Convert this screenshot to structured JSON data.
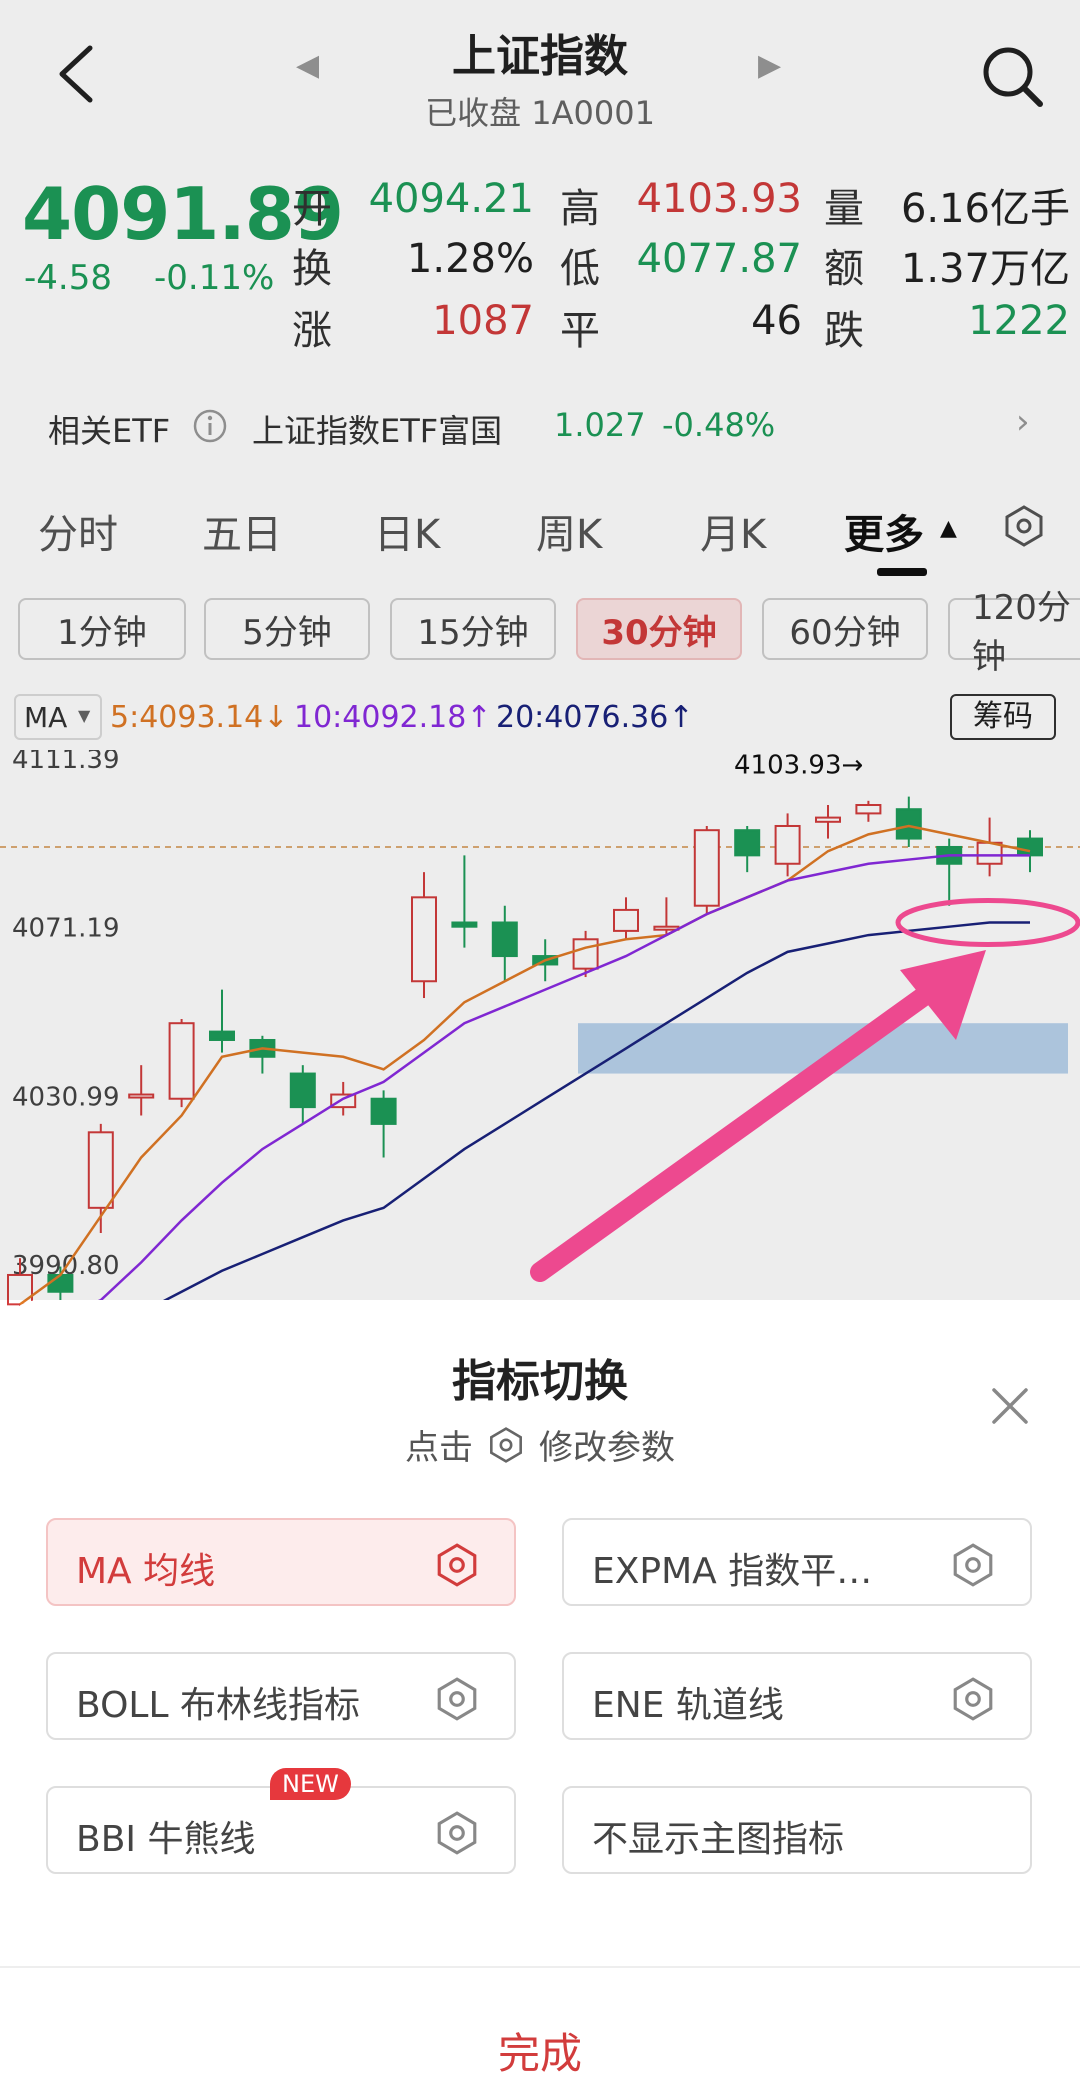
{
  "header": {
    "title": "上证指数",
    "subtitle": "已收盘 1A0001"
  },
  "quote": {
    "price": "4091.89",
    "change": "-4.58",
    "change_pct": "-0.11%",
    "stats": [
      {
        "label": "开",
        "value": "4094.21",
        "color": "green"
      },
      {
        "label": "高",
        "value": "4103.93",
        "color": "red"
      },
      {
        "label": "量",
        "value": "6.16亿手",
        "color": "dark"
      },
      {
        "label": "换",
        "value": "1.28%",
        "color": "dark"
      },
      {
        "label": "低",
        "value": "4077.87",
        "color": "green"
      },
      {
        "label": "额",
        "value": "1.37万亿",
        "color": "dark"
      },
      {
        "label": "涨",
        "value": "1087",
        "color": "red"
      },
      {
        "label": "平",
        "value": "46",
        "color": "dark"
      },
      {
        "label": "跌",
        "value": "1222",
        "color": "green"
      }
    ]
  },
  "etf": {
    "label": "相关ETF",
    "name": "上证指数ETF富国",
    "price": "1.027",
    "change": "-0.48%"
  },
  "tabs": [
    "分时",
    "五日",
    "日K",
    "周K",
    "月K",
    "更多"
  ],
  "active_tab": "更多",
  "periods": [
    "1分钟",
    "5分钟",
    "15分钟",
    "30分钟",
    "60分钟",
    "120分钟"
  ],
  "active_period": "30分钟",
  "ma": {
    "selector": "MA",
    "ma5": "5:4093.14↓",
    "ma10": "10:4092.18↑",
    "ma20": "20:4076.36↑",
    "chip_button": "筹码"
  },
  "chart_data": {
    "type": "candlestick",
    "y_ticks": [
      "4111.39",
      "4071.19",
      "4030.99",
      "3990.80"
    ],
    "high_marker": "4103.93→",
    "series_colors": {
      "ma5": "#e07a26",
      "ma10": "#8a2be2",
      "ma20": "#1a237e",
      "up": "#d23c3c",
      "down": "#1e9c5a"
    },
    "candles": [
      {
        "o": 3985,
        "c": 3992,
        "h": 3996,
        "l": 3982
      },
      {
        "o": 3992,
        "c": 3988,
        "h": 3994,
        "l": 3984
      },
      {
        "o": 4008,
        "c": 4026,
        "h": 4028,
        "l": 4002
      },
      {
        "o": 4035,
        "c": 4035,
        "h": 4042,
        "l": 4030
      },
      {
        "o": 4034,
        "c": 4052,
        "h": 4053,
        "l": 4032
      },
      {
        "o": 4050,
        "c": 4048,
        "h": 4060,
        "l": 4045
      },
      {
        "o": 4048,
        "c": 4044,
        "h": 4049,
        "l": 4040
      },
      {
        "o": 4040,
        "c": 4032,
        "h": 4042,
        "l": 4028
      },
      {
        "o": 4032,
        "c": 4035,
        "h": 4038,
        "l": 4030
      },
      {
        "o": 4034,
        "c": 4028,
        "h": 4036,
        "l": 4020
      },
      {
        "o": 4062,
        "c": 4082,
        "h": 4088,
        "l": 4058
      },
      {
        "o": 4076,
        "c": 4075,
        "h": 4092,
        "l": 4070
      },
      {
        "o": 4076,
        "c": 4068,
        "h": 4080,
        "l": 4062
      },
      {
        "o": 4068,
        "c": 4066,
        "h": 4072,
        "l": 4062
      },
      {
        "o": 4065,
        "c": 4072,
        "h": 4074,
        "l": 4063
      },
      {
        "o": 4074,
        "c": 4079,
        "h": 4082,
        "l": 4072
      },
      {
        "o": 4075,
        "c": 4075,
        "h": 4082,
        "l": 4073
      },
      {
        "o": 4080,
        "c": 4098,
        "h": 4099,
        "l": 4078
      },
      {
        "o": 4098,
        "c": 4092,
        "h": 4099,
        "l": 4088
      },
      {
        "o": 4090,
        "c": 4099,
        "h": 4102,
        "l": 4087
      },
      {
        "o": 4100,
        "c": 4101,
        "h": 4104,
        "l": 4096
      },
      {
        "o": 4102,
        "c": 4104,
        "h": 4105,
        "l": 4100
      },
      {
        "o": 4103,
        "c": 4096,
        "h": 4106,
        "l": 4094
      },
      {
        "o": 4094,
        "c": 4090,
        "h": 4096,
        "l": 4080
      },
      {
        "o": 4090,
        "c": 4095,
        "h": 4101,
        "l": 4087
      },
      {
        "o": 4096,
        "c": 4092,
        "h": 4098,
        "l": 4088
      }
    ],
    "ma5": [
      3985,
      3992,
      4006,
      4020,
      4030,
      4044,
      4046,
      4045,
      4044,
      4041,
      4048,
      4057,
      4062,
      4067,
      4070,
      4072,
      4073,
      4078,
      4082,
      4086,
      4093,
      4097,
      4099,
      4097,
      4095,
      4093
    ],
    "ma10": [
      3980,
      3982,
      3986,
      3995,
      4005,
      4014,
      4022,
      4028,
      4034,
      4038,
      4045,
      4052,
      4056,
      4060,
      4064,
      4068,
      4073,
      4078,
      4082,
      4086,
      4088,
      4090,
      4091,
      4092,
      4092,
      4092
    ],
    "ma20": [
      3975,
      3977,
      3979,
      3983,
      3988,
      3993,
      3997,
      4001,
      4005,
      4008,
      4015,
      4022,
      4028,
      4034,
      4040,
      4046,
      4052,
      4058,
      4064,
      4069,
      4071,
      4073,
      4074,
      4075,
      4076,
      4076
    ]
  },
  "sheet": {
    "title": "指标切换",
    "subtitle_prefix": "点击",
    "subtitle_suffix": "修改参数",
    "options": [
      {
        "label": "MA 均线",
        "selected": true,
        "has_gear": true
      },
      {
        "label": "EXPMA 指数平…",
        "selected": false,
        "has_gear": true
      },
      {
        "label": "BOLL 布林线指标",
        "selected": false,
        "has_gear": true
      },
      {
        "label": "ENE 轨道线",
        "selected": false,
        "has_gear": true
      },
      {
        "label": "BBI 牛熊线",
        "selected": false,
        "has_gear": true,
        "badge": "NEW"
      },
      {
        "label": "不显示主图指标",
        "selected": false,
        "has_gear": false
      }
    ],
    "done": "完成"
  }
}
